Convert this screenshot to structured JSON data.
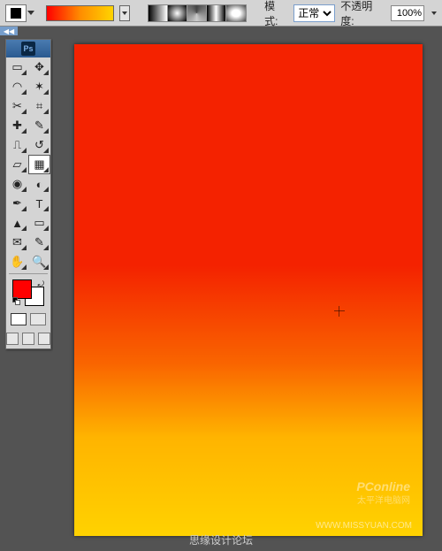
{
  "optionsBar": {
    "mode_label": "模式:",
    "mode_value": "正常",
    "opacity_label": "不透明度:",
    "opacity_value": "100%",
    "gradient_types": [
      "linear",
      "radial",
      "angle",
      "reflected",
      "diamond"
    ]
  },
  "tools": {
    "logo": "Ps",
    "list": [
      {
        "name": "marquee",
        "glyph": "▭"
      },
      {
        "name": "move",
        "glyph": "✥"
      },
      {
        "name": "lasso",
        "glyph": "◠"
      },
      {
        "name": "magic-wand",
        "glyph": "✶"
      },
      {
        "name": "crop",
        "glyph": "✂"
      },
      {
        "name": "slice",
        "glyph": "⌗"
      },
      {
        "name": "healing",
        "glyph": "✚"
      },
      {
        "name": "brush",
        "glyph": "✎"
      },
      {
        "name": "stamp",
        "glyph": "⎍"
      },
      {
        "name": "history-brush",
        "glyph": "↺"
      },
      {
        "name": "eraser",
        "glyph": "▱"
      },
      {
        "name": "gradient",
        "glyph": "▦",
        "active": true
      },
      {
        "name": "blur",
        "glyph": "◉"
      },
      {
        "name": "dodge",
        "glyph": "◐"
      },
      {
        "name": "pen",
        "glyph": "✒"
      },
      {
        "name": "type",
        "glyph": "T"
      },
      {
        "name": "path-select",
        "glyph": "▲"
      },
      {
        "name": "shape",
        "glyph": "▭"
      },
      {
        "name": "notes",
        "glyph": "✉"
      },
      {
        "name": "eyedropper",
        "glyph": "✎"
      },
      {
        "name": "hand",
        "glyph": "✋"
      },
      {
        "name": "zoom",
        "glyph": "🔍"
      }
    ],
    "foreground_color": "#f00000",
    "background_color": "#ffffff"
  },
  "canvas": {
    "gradient_start": "#f42200",
    "gradient_end": "#ffd200"
  },
  "watermarks": {
    "w1": "PConline",
    "w2": "太平洋电脑网",
    "w3": "WWW.MISSYUAN.COM",
    "w4": "思缘设计论坛"
  }
}
